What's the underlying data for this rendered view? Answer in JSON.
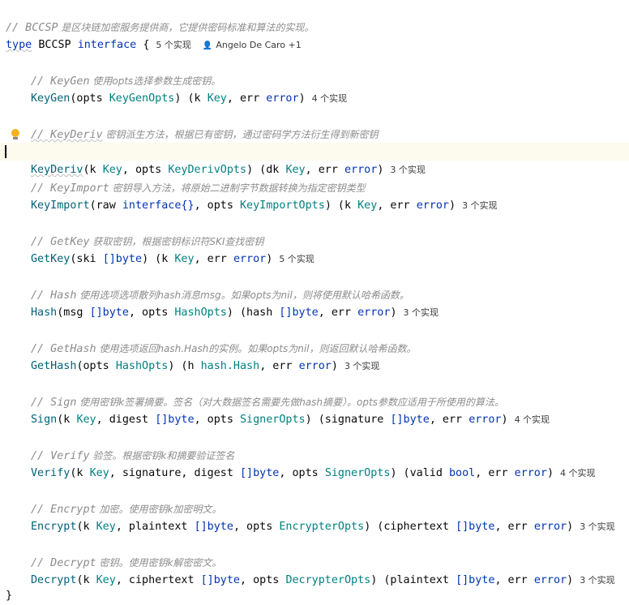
{
  "header": {
    "comment_prefix": "// BCCSP",
    "comment_text": " 是区块链加密服务提供商，它提供密码标准和算法的实现。",
    "kw_type": "type",
    "name": "BCCSP",
    "kw_interface": "interface",
    "open_brace": "{",
    "impl_hint": "5 个实现",
    "author": "Angelo De Caro +1",
    "close_brace": "}"
  },
  "methods": [
    {
      "comment_prefix": "// KeyGen",
      "comment_text": " 使用opts选择参数生成密钥。",
      "name": "KeyGen",
      "sig_open": "(opts ",
      "param_type": "KeyGenOpts",
      "sig_mid": ") (k ",
      "ret_type1": "Key",
      "sig_mid2": ", err ",
      "ret_type2": "error",
      "sig_close": ")",
      "hint": "4 个实现"
    },
    {
      "comment_prefix": "// KeyDeriv",
      "comment_text": " 密钥派生方法，根据已有密钥，通过密码学方法衍生得到新密钥",
      "name": "KeyDeriv",
      "sig_open": "(k ",
      "param_type": "Key",
      "sig_mid_a": ", opts ",
      "param_type2": "KeyDerivOpts",
      "sig_mid": ") (dk ",
      "ret_type1": "Key",
      "sig_mid2": ", err ",
      "ret_type2": "error",
      "sig_close": ")",
      "hint": "3 个实现"
    },
    {
      "comment_prefix": "// KeyImport",
      "comment_text": " 密钥导入方法，将原始二进制字节数据转换为指定密钥类型",
      "name": "KeyImport",
      "sig_open": "(raw ",
      "param_type": "interface{}",
      "sig_mid_a": ", opts ",
      "param_type2": "KeyImportOpts",
      "sig_mid": ") (k ",
      "ret_type1": "Key",
      "sig_mid2": ", err ",
      "ret_type2": "error",
      "sig_close": ")",
      "hint": "3 个实现"
    },
    {
      "comment_prefix": "// GetKey",
      "comment_text": " 获取密钥，根据密钥标识符SKI查找密钥",
      "name": "GetKey",
      "sig_open": "(ski ",
      "param_type": "[]byte",
      "sig_mid": ") (k ",
      "ret_type1": "Key",
      "sig_mid2": ", err ",
      "ret_type2": "error",
      "sig_close": ")",
      "hint": "5 个实现"
    },
    {
      "comment_prefix": "// Hash",
      "comment_text": " 使用选项选项散列hash消息msg。如果opts为nil，则将使用默认哈希函数。",
      "name": "Hash",
      "sig_open": "(msg ",
      "param_type": "[]byte",
      "sig_mid_a": ", opts ",
      "param_type2": "HashOpts",
      "sig_mid": ") (hash ",
      "ret_type1": "[]byte",
      "sig_mid2": ", err ",
      "ret_type2": "error",
      "sig_close": ")",
      "hint": "3 个实现"
    },
    {
      "comment_prefix": "// GetHash",
      "comment_text": " 使用选项返回hash.Hash的实例。如果opts为nil，则返回默认哈希函数。",
      "name": "GetHash",
      "sig_open": "(opts ",
      "param_type": "HashOpts",
      "sig_mid": ") (h ",
      "ret_type1": "hash.Hash",
      "sig_mid2": ", err ",
      "ret_type2": "error",
      "sig_close": ")",
      "hint": "3 个实现"
    },
    {
      "comment_prefix": "// Sign",
      "comment_text": " 使用密钥k签署摘要。签名（对大数据签名需要先做hash摘要）。opts参数应适用于所使用的算法。",
      "name": "Sign",
      "sig_open": "(k ",
      "param_type": "Key",
      "sig_mid_a": ", digest ",
      "param_type2": "[]byte",
      "sig_mid_b": ", opts ",
      "param_type3": "SignerOpts",
      "sig_mid": ") (signature ",
      "ret_type1": "[]byte",
      "sig_mid2": ", err ",
      "ret_type2": "error",
      "sig_close": ")",
      "hint": "4 个实现"
    },
    {
      "comment_prefix": "// Verify",
      "comment_text": " 验签。根据密钥k和摘要验证签名",
      "name": "Verify",
      "sig_open": "(k ",
      "param_type": "Key",
      "sig_mid_a": ", signature, digest ",
      "param_type2": "[]byte",
      "sig_mid_b": ", opts ",
      "param_type3": "SignerOpts",
      "sig_mid": ") (valid ",
      "ret_type1": "bool",
      "sig_mid2": ", err ",
      "ret_type2": "error",
      "sig_close": ")",
      "hint": "4 个实现"
    },
    {
      "comment_prefix": "// Encrypt",
      "comment_text": " 加密。使用密钥k加密明文。",
      "name": "Encrypt",
      "sig_open": "(k ",
      "param_type": "Key",
      "sig_mid_a": ", plaintext ",
      "param_type2": "[]byte",
      "sig_mid_b": ", opts ",
      "param_type3": "EncrypterOpts",
      "sig_mid": ") (ciphertext ",
      "ret_type1": "[]byte",
      "sig_mid2": ", err ",
      "ret_type2": "error",
      "sig_close": ")",
      "hint": "3 个实现"
    },
    {
      "comment_prefix": "// Decrypt",
      "comment_text": " 密钥。使用密钥k解密密文。",
      "name": "Decrypt",
      "sig_open": "(k ",
      "param_type": "Key",
      "sig_mid_a": ", ciphertext ",
      "param_type2": "[]byte",
      "sig_mid_b": ", opts ",
      "param_type3": "DecrypterOpts",
      "sig_mid": ") (plaintext ",
      "ret_type1": "[]byte",
      "sig_mid2": ", err ",
      "ret_type2": "error",
      "sig_close": ")",
      "hint": "3 个实现"
    }
  ],
  "icons": {
    "bulb": "lightbulb-icon",
    "author": "person-icon"
  },
  "colors": {
    "keyword": "#0033b3",
    "type": "#008080",
    "function": "#00627a",
    "comment": "#8c8c8c",
    "caret_line": "#fdfbed",
    "bulb": "#f2b31c"
  }
}
